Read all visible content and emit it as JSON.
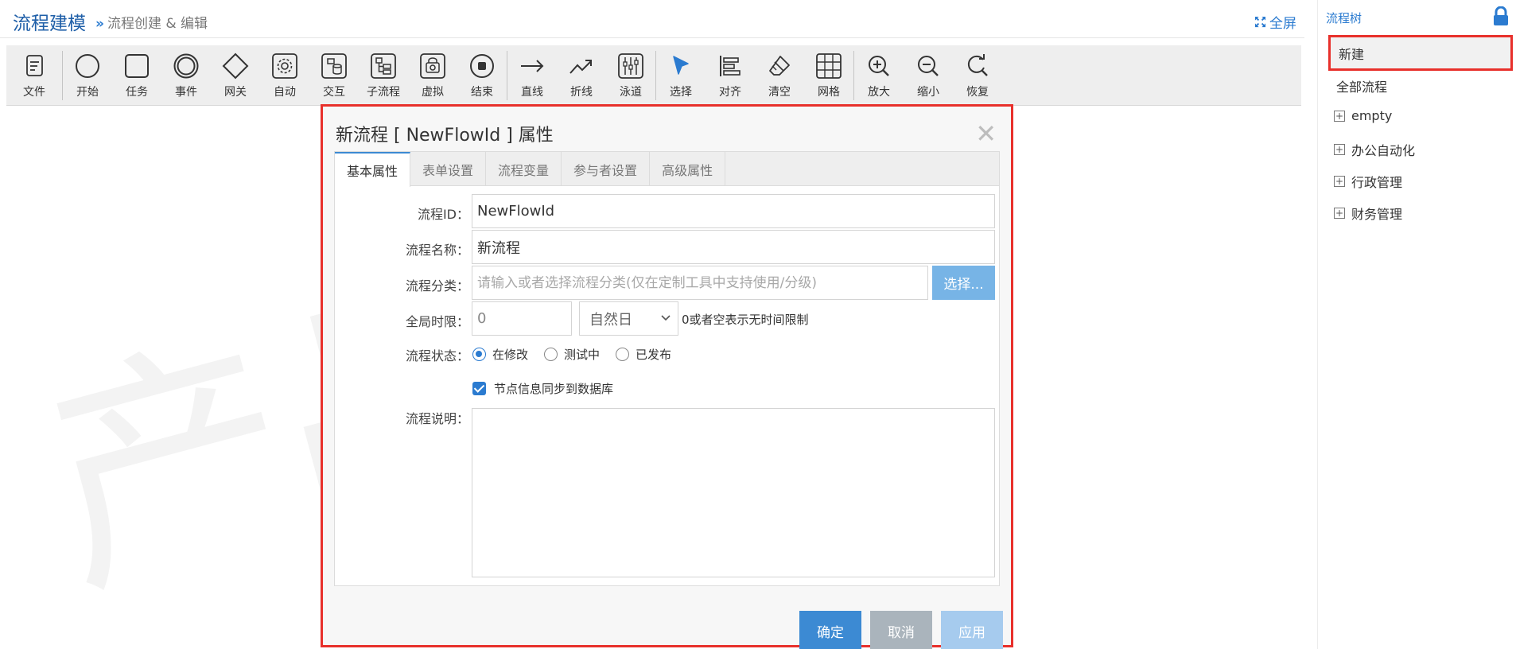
{
  "header": {
    "title": "流程建模",
    "breadcrumb_sep": "»",
    "breadcrumb": "流程创建 & 编辑",
    "fullscreen_label": "全屏"
  },
  "toolbar": {
    "file": "文件",
    "start": "开始",
    "task": "任务",
    "event": "事件",
    "gateway": "网关",
    "auto": "自动",
    "interact": "交互",
    "subprocess": "子流程",
    "virtual": "虚拟",
    "end": "结束",
    "line": "直线",
    "polyline": "折线",
    "swimlane": "泳道",
    "select": "选择",
    "align": "对齐",
    "clear": "清空",
    "grid": "网格",
    "zoom_in": "放大",
    "zoom_out": "缩小",
    "restore": "恢复"
  },
  "watermark": "产品",
  "dialog": {
    "title": "新流程 [ NewFlowId ] 属性",
    "close": "✕",
    "tabs": [
      "基本属性",
      "表单设置",
      "流程变量",
      "参与者设置",
      "高级属性"
    ],
    "active_tab": 0,
    "fields": {
      "flow_id_label": "流程ID：",
      "flow_id_value": "NewFlowId",
      "flow_name_label": "流程名称：",
      "flow_name_value": "新流程",
      "category_label": "流程分类：",
      "category_placeholder": "请输入或者选择流程分类(仅在定制工具中支持使用/分级)",
      "category_button": "选择...",
      "time_limit_label": "全局时限：",
      "time_limit_value": "0",
      "time_unit": "自然日",
      "time_hint": "0或者空表示无时间限制",
      "status_label": "流程状态：",
      "status_options": [
        "在修改",
        "测试中",
        "已发布"
      ],
      "status_selected": 0,
      "sync_label": "节点信息同步到数据库",
      "sync_checked": true,
      "description_label": "流程说明：",
      "description_value": ""
    },
    "buttons": {
      "ok": "确定",
      "cancel": "取消",
      "apply": "应用"
    }
  },
  "tree": {
    "title": "流程树",
    "items": [
      {
        "label": "新建",
        "expandable": false
      },
      {
        "label": "全部流程",
        "expandable": false
      },
      {
        "label": "empty",
        "expandable": true
      },
      {
        "label": "办公自动化",
        "expandable": true
      },
      {
        "label": "行政管理",
        "expandable": true
      },
      {
        "label": "财务管理",
        "expandable": true
      }
    ],
    "plus_glyph": "+"
  },
  "colors": {
    "accent": "#2b7bd0",
    "highlight_border": "#e8302b",
    "primary_button": "#3c8ad3",
    "disabled_button": "#aab4bc",
    "apply_button": "#a6cbee"
  }
}
